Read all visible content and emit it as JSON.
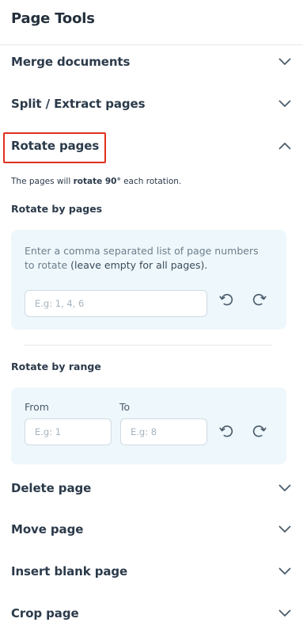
{
  "panel": {
    "title": "Page Tools"
  },
  "sections": {
    "merge": {
      "label": "Merge documents"
    },
    "split": {
      "label": "Split / Extract pages"
    },
    "rotate": {
      "label": "Rotate pages"
    },
    "delete": {
      "label": "Delete page"
    },
    "move": {
      "label": "Move page"
    },
    "insert": {
      "label": "Insert blank page"
    },
    "crop": {
      "label": "Crop page"
    }
  },
  "rotate": {
    "note_prefix": "The pages will ",
    "note_bold": "rotate 90°",
    "note_suffix": " each rotation.",
    "by_pages": {
      "heading": "Rotate by pages",
      "desc_part1": "Enter a comma separated list of page numbers to rotate ",
      "desc_part2": "(leave empty for all pages).",
      "input_placeholder": "E.g: 1, 4, 6",
      "input_value": ""
    },
    "by_range": {
      "heading": "Rotate by range",
      "from_label": "From",
      "to_label": "To",
      "from_placeholder": "E.g: 1",
      "to_placeholder": "E.g: 8",
      "from_value": "",
      "to_value": ""
    }
  },
  "icons": {
    "collapsed": "chevron-down-icon",
    "expanded": "chevron-up-icon",
    "rotate_left": "rotate-ccw-icon",
    "rotate_right": "rotate-cw-icon"
  },
  "colors": {
    "text": "#2b3a4a",
    "muted": "#6c7e8c",
    "card_bg": "#eef7fb",
    "highlight_border": "#e0301e",
    "icon": "#4a5b6a"
  }
}
